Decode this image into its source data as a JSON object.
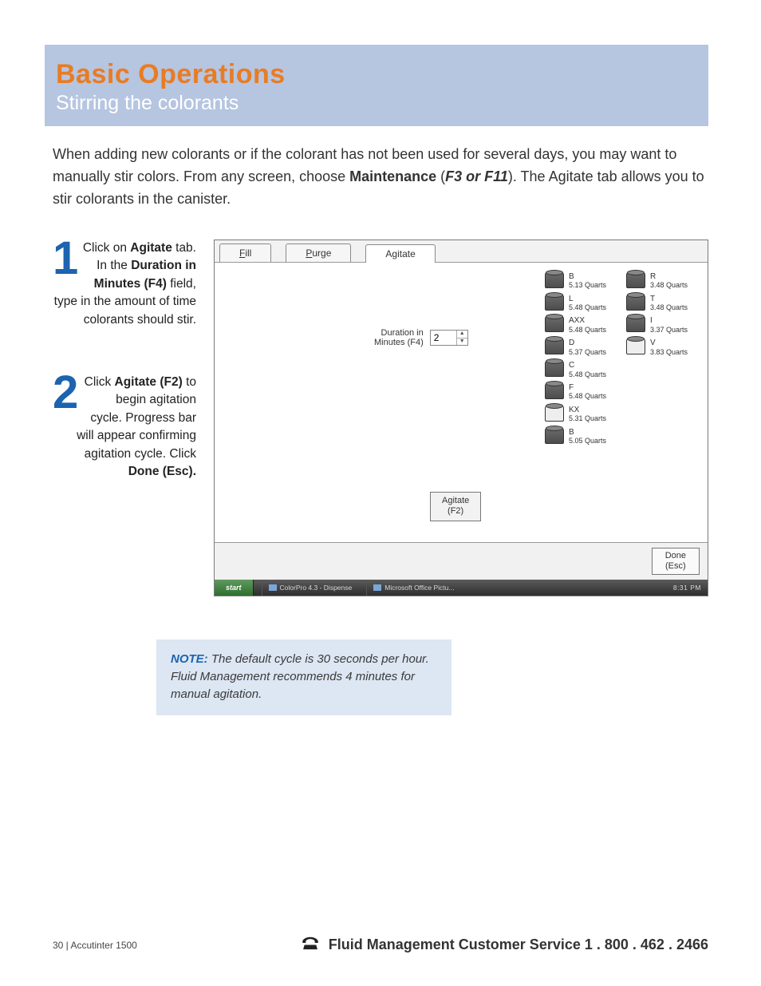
{
  "banner": {
    "title": "Basic Operations",
    "subtitle": "Stirring the colorants"
  },
  "intro": {
    "p1a": "When adding new colorants or if the colorant has not been used for several days, you may want to manually stir colors. From any screen, choose ",
    "bold1": "Maintenance",
    "p1b": " (",
    "ital1": "F3 or F11",
    "p1c": "). The Agitate tab allows you to stir colorants in the canister."
  },
  "steps": {
    "s1": {
      "num": "1",
      "a": "Click on ",
      "b1": "Agitate",
      "c": " tab. In the ",
      "b2": "Duration in Minutes (F4)",
      "d": " field, type in the amount of time colorants should stir."
    },
    "s2": {
      "num": "2",
      "a": "Click ",
      "b1": "Agitate (F2)",
      "c": " to begin agitation cycle. Progress bar will appear confirming agitation cycle. Click ",
      "b2": "Done (Esc)."
    }
  },
  "tabs": {
    "fill_u": "F",
    "fill_r": "ill",
    "purge_u": "P",
    "purge_r": "urge",
    "agitate": "Agitate"
  },
  "shot": {
    "dur_line1": "Duration in",
    "dur_line2": "Minutes (F4)",
    "dur_value": "2",
    "agitate_btn_l1": "Agitate",
    "agitate_btn_l2": "(F2)",
    "done_l1": "Done",
    "done_l2": "(Esc)"
  },
  "cans": [
    {
      "code": "B",
      "qty": "5.13 Quarts",
      "empty": false
    },
    {
      "code": "R",
      "qty": "3.48 Quarts",
      "empty": false
    },
    {
      "code": "L",
      "qty": "5.48 Quarts",
      "empty": false
    },
    {
      "code": "T",
      "qty": "3.48 Quarts",
      "empty": false
    },
    {
      "code": "AXX",
      "qty": "5.48 Quarts",
      "empty": false
    },
    {
      "code": "I",
      "qty": "3.37 Quarts",
      "empty": false
    },
    {
      "code": "D",
      "qty": "5.37 Quarts",
      "empty": false
    },
    {
      "code": "V",
      "qty": "3.83 Quarts",
      "empty": true
    },
    {
      "code": "C",
      "qty": "5.48 Quarts",
      "empty": false
    },
    {
      "code": "",
      "qty": "",
      "empty": null
    },
    {
      "code": "F",
      "qty": "5.48 Quarts",
      "empty": false
    },
    {
      "code": "",
      "qty": "",
      "empty": null
    },
    {
      "code": "KX",
      "qty": "5.31 Quarts",
      "empty": true
    },
    {
      "code": "",
      "qty": "",
      "empty": null
    },
    {
      "code": "B",
      "qty": "5.05 Quarts",
      "empty": false
    },
    {
      "code": "",
      "qty": "",
      "empty": null
    }
  ],
  "taskbar": {
    "start": "start",
    "item1": "ColorPro 4.3 - Dispense",
    "item2": "Microsoft Office Pictu...",
    "tray": "8:31 PM"
  },
  "note": {
    "label": "NOTE:",
    "body": " The default cycle is 30 seconds per hour. Fluid Management recommends 4 minutes for manual agitation."
  },
  "footer": {
    "page_left": "30   |   Accutinter 1500",
    "right": "Fluid Management Customer Service 1 . 800 . 462 . 2466"
  }
}
